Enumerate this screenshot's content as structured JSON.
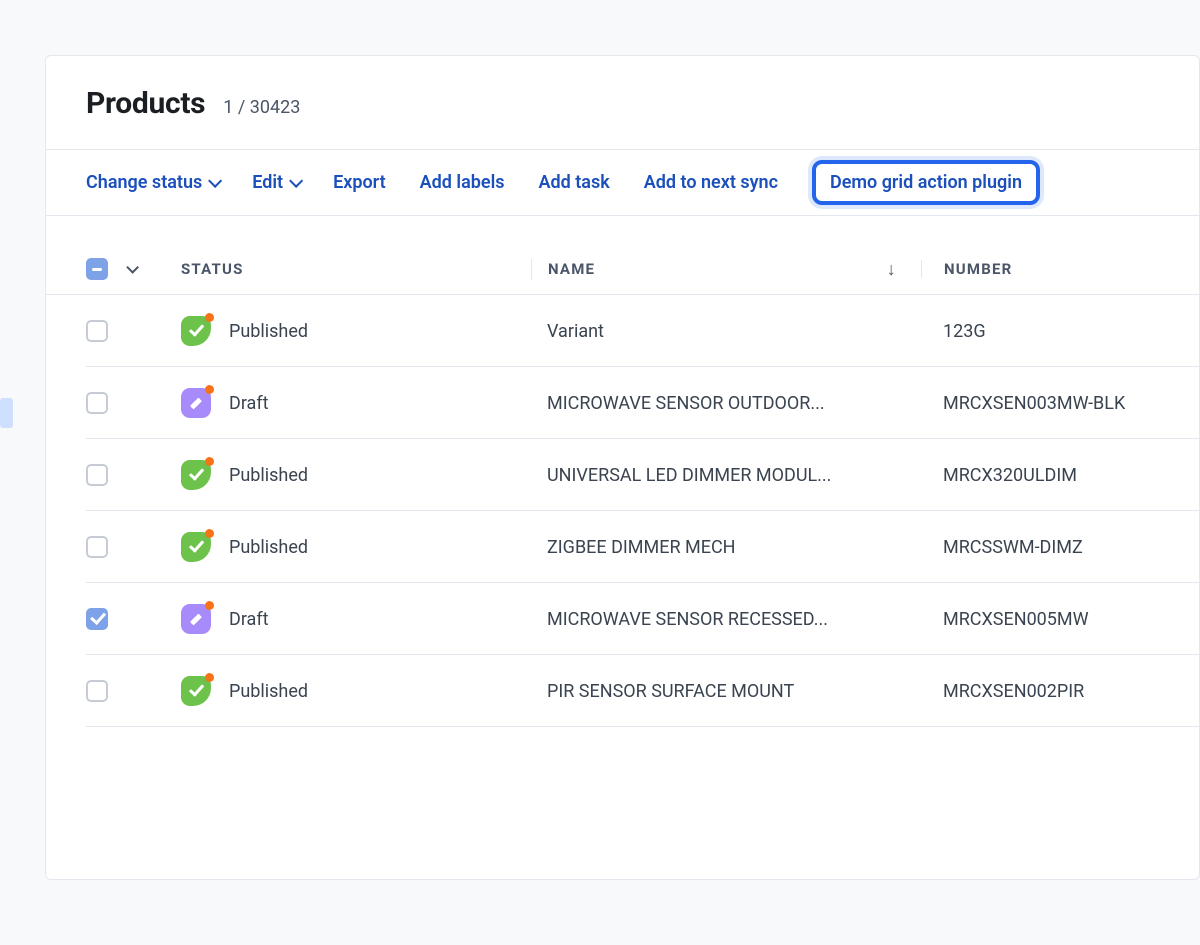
{
  "header": {
    "title": "Products",
    "counter": "1 / 30423"
  },
  "toolbar": {
    "change_status": "Change status",
    "edit": "Edit",
    "export": "Export",
    "add_labels": "Add labels",
    "add_task": "Add task",
    "add_to_next_sync": "Add to next sync",
    "demo_plugin": "Demo grid action plugin"
  },
  "columns": {
    "status": "STATUS",
    "name": "NAME",
    "number": "NUMBER"
  },
  "status_labels": {
    "published": "Published",
    "draft": "Draft"
  },
  "rows": [
    {
      "checked": false,
      "status": "published",
      "name": "Variant",
      "number": "123G"
    },
    {
      "checked": false,
      "status": "draft",
      "name": "MICROWAVE SENSOR OUTDOOR...",
      "number": "MRCXSEN003MW-BLK"
    },
    {
      "checked": false,
      "status": "published",
      "name": "UNIVERSAL LED DIMMER MODUL...",
      "number": "MRCX320ULDIM"
    },
    {
      "checked": false,
      "status": "published",
      "name": "ZIGBEE DIMMER MECH",
      "number": "MRCSSWM-DIMZ"
    },
    {
      "checked": true,
      "status": "draft",
      "name": "MICROWAVE SENSOR RECESSED...",
      "number": "MRCXSEN005MW"
    },
    {
      "checked": false,
      "status": "published",
      "name": "PIR SENSOR SURFACE MOUNT",
      "number": "MRCXSEN002PIR"
    }
  ]
}
